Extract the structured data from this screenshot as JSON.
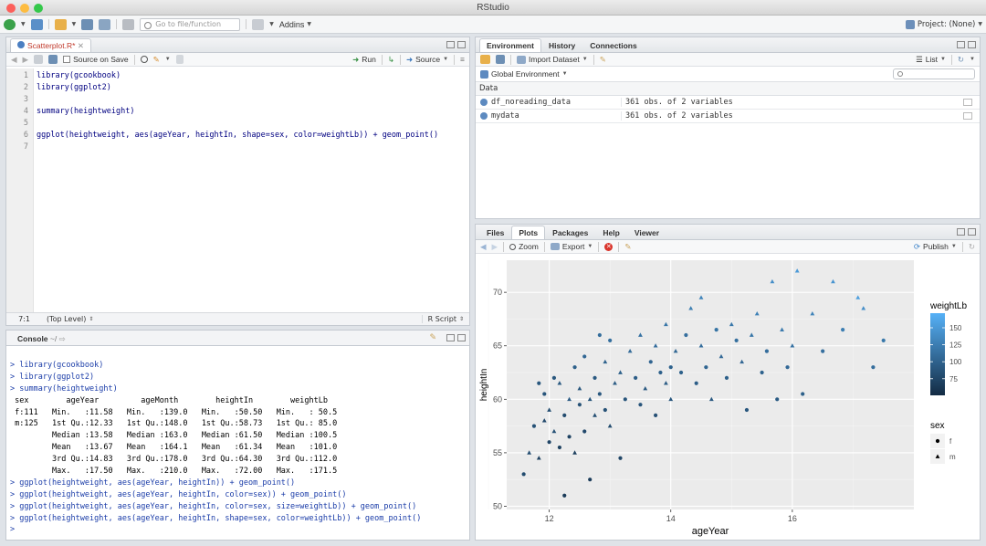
{
  "window": {
    "title": "RStudio"
  },
  "toolbar": {
    "goto_placeholder": "Go to file/function",
    "addins_label": "Addins",
    "project_label": "Project: (None)"
  },
  "editor": {
    "tab_label": "Scatterplot.R*",
    "source_on_save": "Source on Save",
    "run_label": "Run",
    "source_label": "Source",
    "line_numbers": [
      "1",
      "2",
      "3",
      "4",
      "5",
      "6",
      "7"
    ],
    "lines": [
      "library(gcookbook)",
      "library(ggplot2)",
      "",
      "summary(heightweight)",
      "",
      "ggplot(heightweight, aes(ageYear, heightIn, shape=sex, color=weightLb)) + geom_point()",
      ""
    ],
    "cursor_pos": "7:1",
    "scope": "(Top Level)",
    "file_type": "R Script"
  },
  "console": {
    "tab_label": "Console",
    "path": "~/",
    "lines": [
      {
        "cls": "cmd",
        "text": "> library(gcookbook)"
      },
      {
        "cls": "cmd",
        "text": "> library(ggplot2)"
      },
      {
        "cls": "cmd",
        "text": "> summary(heightweight)"
      },
      {
        "cls": "out",
        "text": " sex        ageYear         ageMonth        heightIn        weightLb"
      },
      {
        "cls": "out",
        "text": " f:111   Min.   :11.58   Min.   :139.0   Min.   :50.50   Min.   : 50.5"
      },
      {
        "cls": "out",
        "text": " m:125   1st Qu.:12.33   1st Qu.:148.0   1st Qu.:58.73   1st Qu.: 85.0"
      },
      {
        "cls": "out",
        "text": "         Median :13.58   Median :163.0   Median :61.50   Median :100.5"
      },
      {
        "cls": "out",
        "text": "         Mean   :13.67   Mean   :164.1   Mean   :61.34   Mean   :101.0"
      },
      {
        "cls": "out",
        "text": "         3rd Qu.:14.83   3rd Qu.:178.0   3rd Qu.:64.30   3rd Qu.:112.0"
      },
      {
        "cls": "out",
        "text": "         Max.   :17.50   Max.   :210.0   Max.   :72.00   Max.   :171.5"
      },
      {
        "cls": "cmd",
        "text": "> ggplot(heightweight, aes(ageYear, heightIn)) + geom_point()"
      },
      {
        "cls": "cmd",
        "text": "> ggplot(heightweight, aes(ageYear, heightIn, color=sex)) + geom_point()"
      },
      {
        "cls": "cmd",
        "text": "> ggplot(heightweight, aes(ageYear, heightIn, color=sex, size=weightLb)) + geom_point()"
      },
      {
        "cls": "cmd",
        "text": "> ggplot(heightweight, aes(ageYear, heightIn, shape=sex, color=weightLb)) + geom_point()"
      },
      {
        "cls": "cmd",
        "text": "> "
      }
    ]
  },
  "env": {
    "tabs": [
      "Environment",
      "History",
      "Connections"
    ],
    "import_label": "Import Dataset",
    "list_label": "List",
    "global_env": "Global Environment",
    "section": "Data",
    "rows": [
      {
        "name": "df_noreading_data",
        "value": "361 obs. of 2 variables"
      },
      {
        "name": "mydata",
        "value": "361 obs. of 2 variables"
      }
    ]
  },
  "files": {
    "tabs": [
      "Files",
      "Plots",
      "Packages",
      "Help",
      "Viewer"
    ],
    "zoom_label": "Zoom",
    "export_label": "Export",
    "publish_label": "Publish"
  },
  "chart_data": {
    "type": "scatter",
    "xlabel": "ageYear",
    "ylabel": "heightIn",
    "xlim": [
      11.3,
      18.0
    ],
    "ylim": [
      49.7,
      73.0
    ],
    "xticks": [
      12,
      14,
      16
    ],
    "yticks": [
      50,
      55,
      60,
      65,
      70
    ],
    "color_legend": {
      "title": "weightLb",
      "ticks": [
        75,
        100,
        125,
        150
      ],
      "low": "#132B43",
      "high": "#56B1F7",
      "range": [
        50.5,
        171.5
      ]
    },
    "shape_legend": {
      "title": "sex",
      "items": [
        "f",
        "m"
      ]
    },
    "grid": true,
    "points": [
      [
        11.58,
        53.0,
        80,
        "f"
      ],
      [
        11.67,
        55.0,
        82,
        "m"
      ],
      [
        11.75,
        57.5,
        85,
        "f"
      ],
      [
        11.83,
        61.5,
        90,
        "f"
      ],
      [
        11.83,
        54.5,
        70,
        "m"
      ],
      [
        11.92,
        58.0,
        78,
        "m"
      ],
      [
        11.92,
        60.5,
        88,
        "f"
      ],
      [
        12.0,
        56.0,
        75,
        "f"
      ],
      [
        12.0,
        59.0,
        82,
        "m"
      ],
      [
        12.08,
        62.0,
        90,
        "f"
      ],
      [
        12.08,
        57.0,
        85,
        "m"
      ],
      [
        12.17,
        55.5,
        70,
        "f"
      ],
      [
        12.17,
        61.5,
        92,
        "m"
      ],
      [
        12.25,
        58.5,
        80,
        "f"
      ],
      [
        12.25,
        51.0,
        65,
        "f"
      ],
      [
        12.33,
        60.0,
        95,
        "m"
      ],
      [
        12.33,
        56.5,
        72,
        "f"
      ],
      [
        12.42,
        63.0,
        98,
        "f"
      ],
      [
        12.42,
        55.0,
        70,
        "m"
      ],
      [
        12.5,
        59.5,
        85,
        "f"
      ],
      [
        12.5,
        61.0,
        90,
        "m"
      ],
      [
        12.58,
        57.0,
        78,
        "f"
      ],
      [
        12.58,
        64.0,
        105,
        "f"
      ],
      [
        12.67,
        60.0,
        88,
        "m"
      ],
      [
        12.67,
        52.5,
        66,
        "f"
      ],
      [
        12.75,
        62.0,
        92,
        "f"
      ],
      [
        12.75,
        58.5,
        82,
        "m"
      ],
      [
        12.83,
        66.0,
        110,
        "f"
      ],
      [
        12.83,
        60.5,
        90,
        "f"
      ],
      [
        12.92,
        63.5,
        100,
        "m"
      ],
      [
        12.92,
        59.0,
        85,
        "f"
      ],
      [
        13.0,
        65.5,
        112,
        "f"
      ],
      [
        13.0,
        57.5,
        80,
        "m"
      ],
      [
        13.08,
        61.5,
        95,
        "m"
      ],
      [
        13.17,
        54.5,
        75,
        "f"
      ],
      [
        13.17,
        62.5,
        98,
        "m"
      ],
      [
        13.25,
        60.0,
        88,
        "f"
      ],
      [
        13.33,
        64.5,
        108,
        "m"
      ],
      [
        13.42,
        62.0,
        96,
        "f"
      ],
      [
        13.5,
        66.0,
        115,
        "m"
      ],
      [
        13.5,
        59.5,
        88,
        "f"
      ],
      [
        13.58,
        61.0,
        92,
        "m"
      ],
      [
        13.67,
        63.5,
        102,
        "f"
      ],
      [
        13.75,
        65.0,
        110,
        "m"
      ],
      [
        13.75,
        58.5,
        84,
        "f"
      ],
      [
        13.83,
        62.5,
        98,
        "f"
      ],
      [
        13.92,
        61.5,
        95,
        "m"
      ],
      [
        13.92,
        67.0,
        118,
        "m"
      ],
      [
        14.0,
        63.0,
        100,
        "f"
      ],
      [
        14.0,
        60.0,
        90,
        "m"
      ],
      [
        14.08,
        64.5,
        105,
        "m"
      ],
      [
        14.17,
        62.5,
        99,
        "f"
      ],
      [
        14.25,
        66.0,
        112,
        "f"
      ],
      [
        14.33,
        68.5,
        125,
        "m"
      ],
      [
        14.42,
        61.5,
        96,
        "f"
      ],
      [
        14.5,
        65.0,
        110,
        "m"
      ],
      [
        14.5,
        69.5,
        130,
        "m"
      ],
      [
        14.58,
        63.0,
        103,
        "f"
      ],
      [
        14.67,
        60.0,
        92,
        "m"
      ],
      [
        14.75,
        66.5,
        116,
        "f"
      ],
      [
        14.83,
        64.0,
        106,
        "m"
      ],
      [
        14.92,
        62.0,
        98,
        "f"
      ],
      [
        15.0,
        67.0,
        120,
        "m"
      ],
      [
        15.08,
        65.5,
        112,
        "f"
      ],
      [
        15.17,
        63.5,
        104,
        "m"
      ],
      [
        15.25,
        59.0,
        90,
        "f"
      ],
      [
        15.33,
        66.0,
        118,
        "m"
      ],
      [
        15.42,
        68.0,
        128,
        "m"
      ],
      [
        15.5,
        62.5,
        100,
        "f"
      ],
      [
        15.58,
        64.5,
        110,
        "f"
      ],
      [
        15.67,
        71.0,
        140,
        "m"
      ],
      [
        15.75,
        60.0,
        94,
        "f"
      ],
      [
        15.83,
        66.5,
        122,
        "m"
      ],
      [
        15.92,
        63.0,
        106,
        "f"
      ],
      [
        16.0,
        65.0,
        115,
        "m"
      ],
      [
        16.08,
        72.0,
        150,
        "m"
      ],
      [
        16.17,
        60.5,
        98,
        "f"
      ],
      [
        16.33,
        68.0,
        130,
        "m"
      ],
      [
        16.5,
        64.5,
        112,
        "f"
      ],
      [
        16.67,
        71.0,
        145,
        "m"
      ],
      [
        16.83,
        66.5,
        125,
        "f"
      ],
      [
        17.08,
        69.5,
        155,
        "m"
      ],
      [
        17.33,
        63.0,
        110,
        "f"
      ],
      [
        17.5,
        65.5,
        120,
        "f"
      ],
      [
        17.17,
        68.5,
        140,
        "m"
      ]
    ]
  }
}
